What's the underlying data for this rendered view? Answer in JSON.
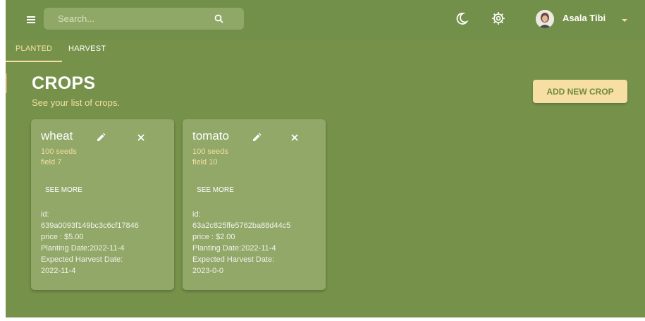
{
  "header": {
    "search_placeholder": "Search...",
    "user_name": "Asala Tibi"
  },
  "tabs": [
    {
      "label": "PLANTED",
      "active": true
    },
    {
      "label": "HARVEST",
      "active": false
    }
  ],
  "page": {
    "title": "CROPS",
    "subtitle": "See your list of crops.",
    "add_button": "ADD NEW CROP"
  },
  "crops": [
    {
      "name": "wheat",
      "seeds": "100 seeds",
      "field": "field 7",
      "see_more": "SEE MORE",
      "id_label": "id:",
      "id": "639a0093f149bc3c6cf17846",
      "price": "price : $5.00",
      "planting_date": "Planting Date:2022-11-4",
      "harvest_label": "Expected Harvest Date:",
      "harvest_date": "2022-11-4"
    },
    {
      "name": "tomato",
      "seeds": "100 seeds",
      "field": "field 10",
      "see_more": "SEE MORE",
      "id_label": "id:",
      "id": "63a2c825ffe5762ba88d44c5",
      "price": "price : $2.00",
      "planting_date": "Planting Date:2022-11-4",
      "harvest_label": "Expected Harvest Date:",
      "harvest_date": "2023-0-0"
    }
  ],
  "colors": {
    "background": "#76924a",
    "card": "#91a868",
    "accent": "#f7dea2",
    "accent_text": "#f3df9e"
  },
  "icons": [
    "menu-icon",
    "search-icon",
    "moon-icon",
    "gear-icon",
    "caret-down-icon",
    "edit-icon",
    "close-icon"
  ]
}
